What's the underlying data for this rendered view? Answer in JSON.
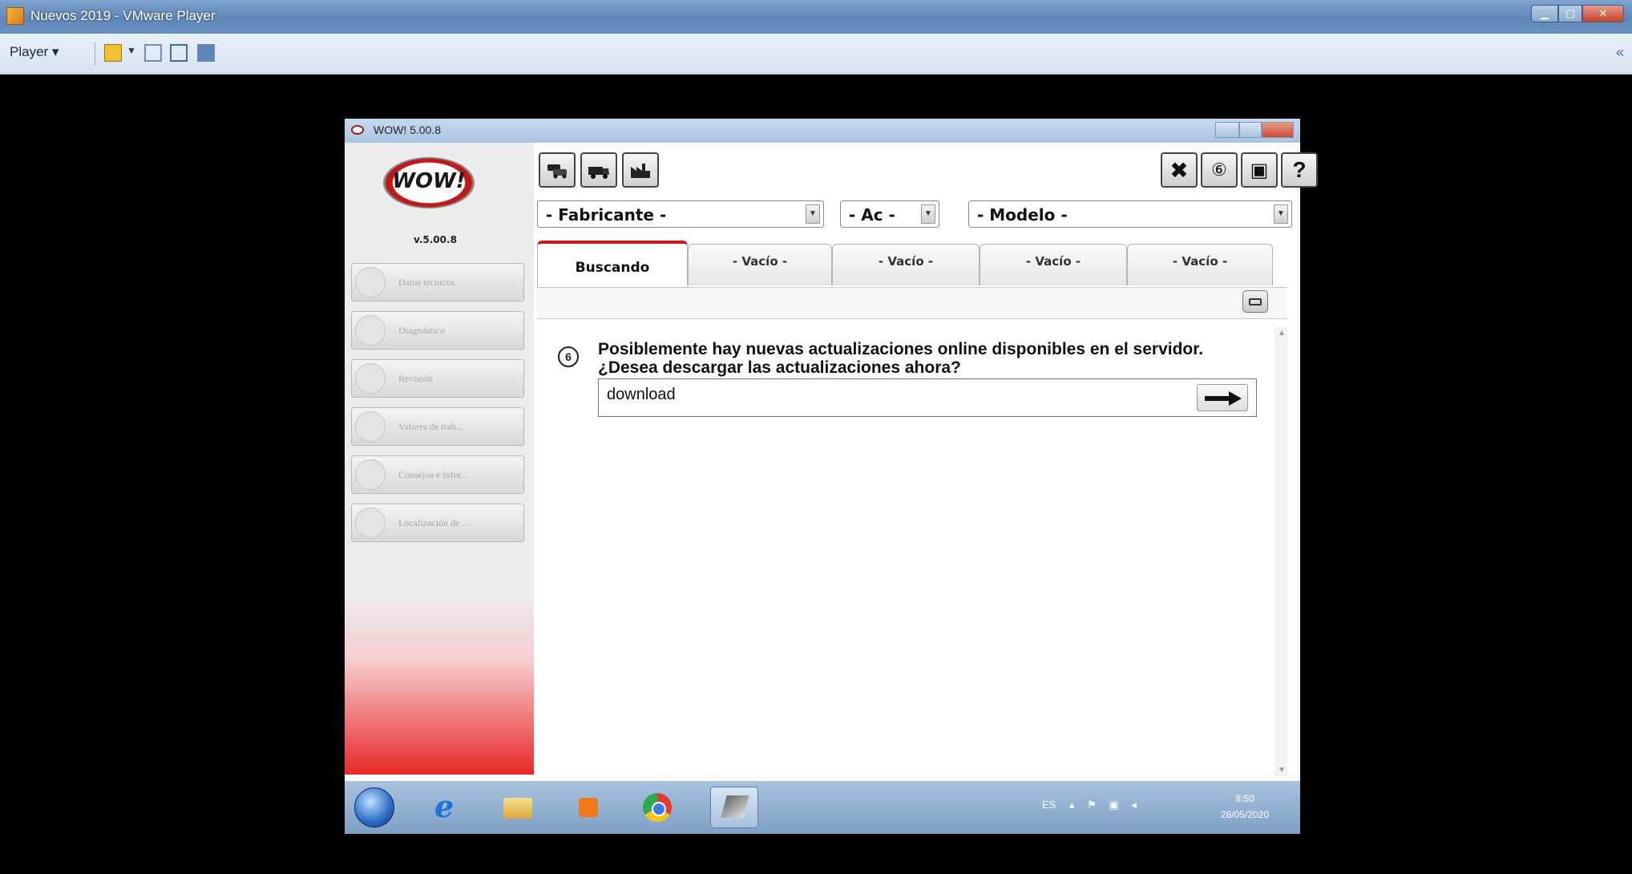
{
  "host": {
    "title": "Nuevos 2019 - VMware Player",
    "player_menu": "Player ▾",
    "colors": {
      "titlebar": "#6d93c2",
      "toolbar": "#dfe8f3",
      "background": "#000000"
    }
  },
  "guest_window": {
    "title": "WOW! 5.00.8",
    "logo_text": "WOW!",
    "version": "v.5.00.8",
    "nav": [
      {
        "label": "Datos técnicos",
        "icon": "document-icon"
      },
      {
        "label": "Diagnóstico",
        "icon": "diagnostic-icon"
      },
      {
        "label": "Revisión",
        "icon": "wrench-icon"
      },
      {
        "label": "Valores de trab...",
        "icon": "gauge-icon"
      },
      {
        "label": "Consejos e infor...",
        "icon": "bulb-icon"
      },
      {
        "label": "Localización de ...",
        "icon": "locate-icon"
      }
    ],
    "toolbar": {
      "left_icons": [
        "cars-icon",
        "truck-icon",
        "industry-icon"
      ],
      "right_icons": [
        "tools-icon",
        "update-icon",
        "box-icon",
        "help-icon",
        "close-icon"
      ],
      "right_glyphs": [
        "✖",
        "⑥",
        "▣",
        "?",
        "✕"
      ]
    },
    "selectors": {
      "fabricante": "- Fabricante -",
      "ac": "- Ac -",
      "modelo": "- Modelo -"
    },
    "tabs": [
      "Buscando",
      "- Vacío -",
      "- Vacío -",
      "- Vacío -",
      "- Vacío -"
    ],
    "active_tab": 0,
    "search_value": "",
    "update_message": "Posiblemente hay nuevas actualizaciones online disponibles en el servidor. ¿Desea descargar las actualizaciones ahora?",
    "download_label": "download",
    "accent_color": "#d01818"
  },
  "taskbar": {
    "apps": [
      "start-orb",
      "internet-explorer",
      "file-explorer",
      "media-player",
      "chrome",
      "wow-app"
    ],
    "language": "ES",
    "time": "8:50",
    "date": "28/05/2020"
  }
}
